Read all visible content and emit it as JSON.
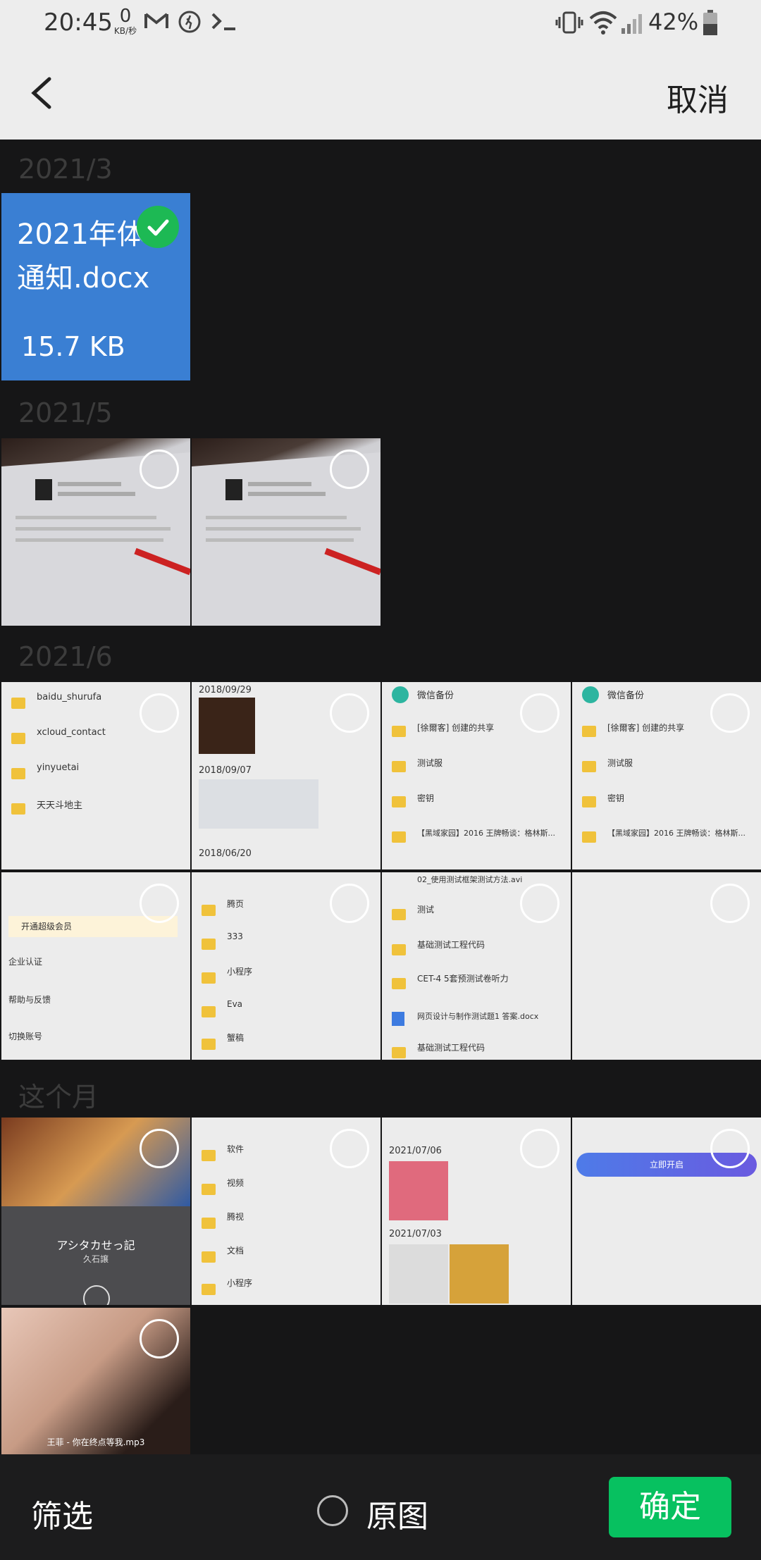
{
  "status_bar": {
    "time": "20:45",
    "net_speed_value": "0",
    "net_speed_unit": "KB/秒",
    "battery": "42%"
  },
  "header": {
    "cancel_label": "取消"
  },
  "sections": [
    {
      "date": "2021/3"
    },
    {
      "date": "2021/5"
    },
    {
      "date": "2021/6"
    },
    {
      "date": "这个月"
    }
  ],
  "doc_tile": {
    "name": "2021年体\n通知.docx",
    "size": "15.7 KB",
    "selected": true
  },
  "thumb_text": {
    "t3a": [
      "baidu_shurufa",
      "xcloud_contact",
      "yinyuetai",
      "天天斗地主"
    ],
    "t3b": [
      "2018/09/29",
      "2018/09/07",
      "2018/06/20"
    ],
    "t3c_title": "微信备份",
    "t3c": [
      "[徐爾客] 创建的共享",
      "测试服",
      "密钥",
      "【黑域家园】2016 王牌畅谈：格林斯..."
    ],
    "t3d_title": "微信备份",
    "t3d": [
      "[徐爾客] 创建的共享",
      "测试服",
      "密钥",
      "【黑域家园】2016 王牌畅谈：格林斯..."
    ],
    "t4a": [
      "开通超级会员",
      "企业认证",
      "帮助与反馈",
      "切换账号"
    ],
    "t4b": [
      "腾页",
      "333",
      "小程序",
      "Eva",
      "蟹稿"
    ],
    "t4c": [
      "02_使用测试框架测试方法.avi",
      "测试",
      "基础测试工程代码",
      "CET-4 5套预测试卷听力",
      "网页设计与制作测试题1 答案.docx",
      "基础测试工程代码"
    ],
    "t5b": [
      "软件",
      "视频",
      "腾视",
      "文档",
      "小程序"
    ],
    "t5c": [
      "2021/07/06",
      "2021/07/03"
    ],
    "t5d_button": "立即开启",
    "t5a_title": "アシタカせっ記",
    "t5a_sub": "久石譲",
    "t6a_caption": "王菲 - 你在终点等我.mp3"
  },
  "bottom_bar": {
    "filter_label": "筛选",
    "original_label": "原图",
    "confirm_label": "确定"
  },
  "colors": {
    "confirm": "#07c160",
    "doc_tile": "#3a7fd3",
    "check": "#1db954"
  }
}
